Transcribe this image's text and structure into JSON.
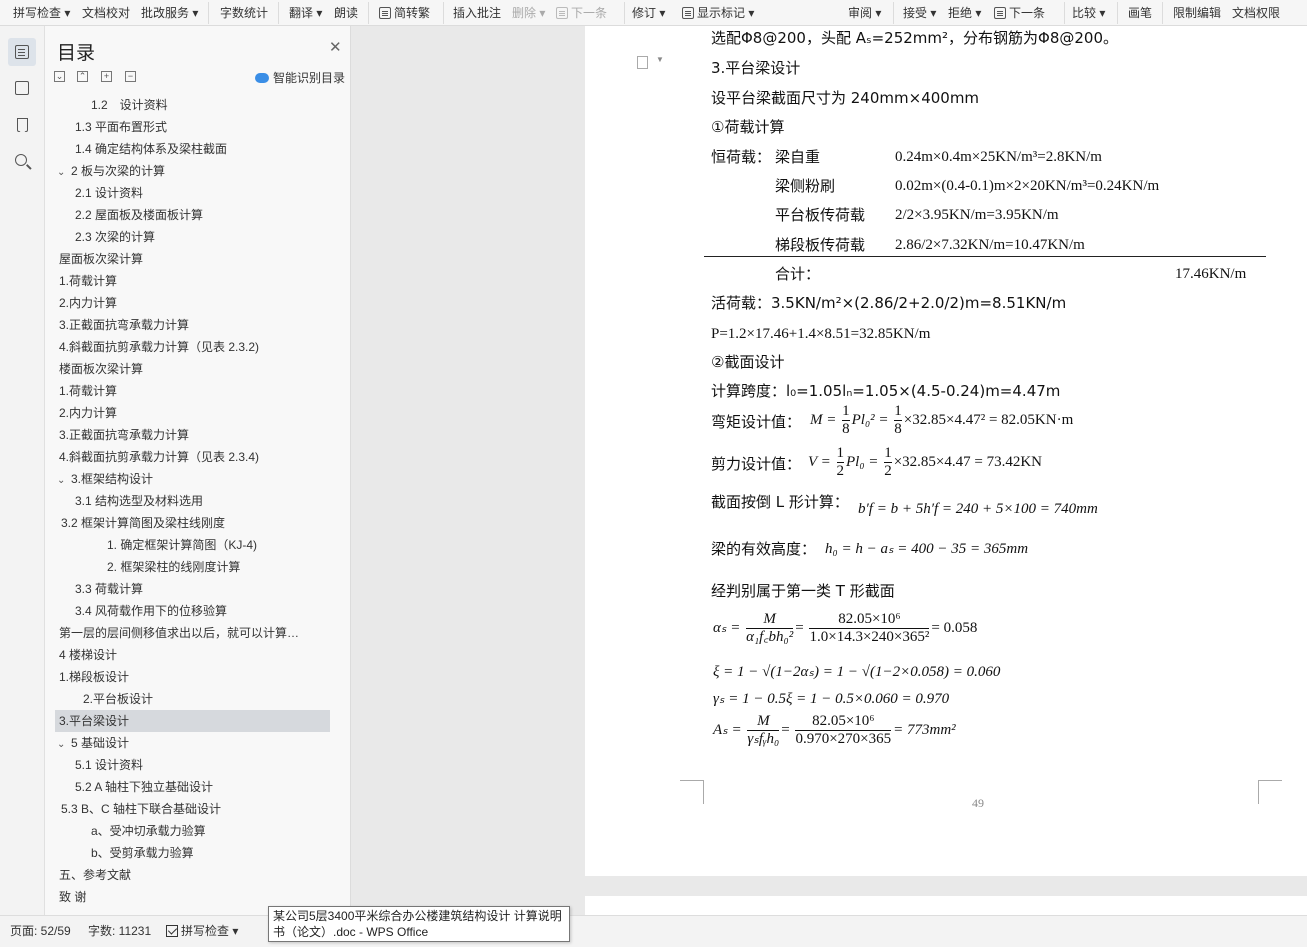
{
  "toolbar": {
    "spellcheck": "拼写检查",
    "proofread": "文档校对",
    "batch": "批改服务",
    "wordcount": "字数统计",
    "translate": "翻译",
    "read": "朗读",
    "simp_trad": "简转繁",
    "insert_comment": "插入批注",
    "delete": "删除",
    "next": "下一条",
    "track": "修订",
    "show_markup": "显示标记",
    "review": "审阅",
    "accept": "接受",
    "reject": "拒绝",
    "next2": "下一条",
    "compare": "比较",
    "pen": "画笔",
    "restrict": "限制编辑",
    "permission": "文档权限"
  },
  "toc": {
    "title": "目录",
    "smart_label": "智能识别目录",
    "items": [
      {
        "text": "1.2　设计资料",
        "toggle": ""
      },
      {
        "text": "1.3  平面布置形式",
        "toggle": ""
      },
      {
        "text": "1.4  确定结构体系及梁柱截面",
        "toggle": ""
      },
      {
        "text": "2  板与次梁的计算",
        "toggle": "⌄"
      },
      {
        "text": "2.1 设计资料",
        "toggle": ""
      },
      {
        "text": "2.2 屋面板及楼面板计算",
        "toggle": ""
      },
      {
        "text": "2.3 次梁的计算",
        "toggle": ""
      },
      {
        "text": "屋面板次梁计算",
        "toggle": ""
      },
      {
        "text": "1.荷载计算",
        "toggle": ""
      },
      {
        "text": "2.内力计算",
        "toggle": ""
      },
      {
        "text": "3.正截面抗弯承载力计算",
        "toggle": ""
      },
      {
        "text": "4.斜截面抗剪承载力计算（见表 2.3.2)",
        "toggle": ""
      },
      {
        "text": "楼面板次梁计算",
        "toggle": ""
      },
      {
        "text": "1.荷载计算",
        "toggle": ""
      },
      {
        "text": "2.内力计算",
        "toggle": ""
      },
      {
        "text": "3.正截面抗弯承载力计算",
        "toggle": ""
      },
      {
        "text": "4.斜截面抗剪承载力计算（见表 2.3.4)",
        "toggle": ""
      },
      {
        "text": "3.框架结构设计",
        "toggle": "⌄"
      },
      {
        "text": "3.1 结构选型及材料选用",
        "toggle": ""
      },
      {
        "text": "3.2 框架计算简图及梁柱线刚度",
        "toggle": "⌄"
      },
      {
        "text": "1. 确定框架计算简图（KJ-4)",
        "toggle": ""
      },
      {
        "text": "2. 框架梁柱的线刚度计算",
        "toggle": ""
      },
      {
        "text": "3.3 荷载计算",
        "toggle": ""
      },
      {
        "text": "3.4 风荷载作用下的位移验算",
        "toggle": ""
      },
      {
        "text": "第一层的层间侧移值求出以后，就可以计算…",
        "toggle": ""
      },
      {
        "text": "4 楼梯设计",
        "toggle": ""
      },
      {
        "text": "1.梯段板设计",
        "toggle": ""
      },
      {
        "text": "2.平台板设计",
        "toggle": ""
      },
      {
        "text": "3.平台梁设计",
        "toggle": ""
      },
      {
        "text": "5 基础设计",
        "toggle": "⌄"
      },
      {
        "text": "5.1 设计资料",
        "toggle": ""
      },
      {
        "text": "5.2 A 轴柱下独立基础设计",
        "toggle": ""
      },
      {
        "text": "5.3 B、C 轴柱下联合基础设计",
        "toggle": "⌄"
      },
      {
        "text": "a、受冲切承载力验算",
        "toggle": ""
      },
      {
        "text": "b、受剪承载力验算",
        "toggle": ""
      },
      {
        "text": "五、参考文献",
        "toggle": ""
      },
      {
        "text": "致  谢",
        "toggle": ""
      }
    ]
  },
  "doc": {
    "line0": "选配Φ8@200，头配 Aₛ=252mm²，分布钢筋为Φ8@200。",
    "h_beam": "3.平台梁设计",
    "section": "设平台梁截面尺寸为 240mm×400mm",
    "h_load": "①荷载计算",
    "dead_label": "恒荷载：",
    "d1_name": "梁自重",
    "d1_val": "0.24m×0.4m×25KN/m³=2.8KN/m",
    "d2_name": "梁侧粉刷",
    "d2_val": "0.02m×(0.4-0.1)m×2×20KN/m³=0.24KN/m",
    "d3_name": "平台板传荷载",
    "d3_val": "2/2×3.95KN/m=3.95KN/m",
    "d4_name": "梯段板传荷载",
    "d4_val": "2.86/2×7.32KN/m=10.47KN/m",
    "sum_label": "合计：",
    "sum_val": "17.46KN/m",
    "live": "活荷载：3.5KN/m²×(2.86/2+2.0/2)m=8.51KN/m",
    "p": "P=1.2×17.46+1.4×8.51=32.85KN/m",
    "h_sec": "②截面设计",
    "span": "计算跨度：l₀=1.05lₙ=1.05×(4.5-0.24)m=4.47m",
    "moment_label": "弯矩设计值：",
    "moment_tail": "×32.85×4.47² = 82.05KN·m",
    "shear_label": "剪力设计值：",
    "shear_tail": "×32.85×4.47 = 73.42KN",
    "flange_label": "截面按倒 L 形计算：",
    "flange_eq": "b′f = b + 5h′f = 240 + 5×100 = 740mm",
    "h0_label": "梁的有效高度：",
    "h0_eq": "h₀ = h − aₛ = 400 − 35 = 365mm",
    "tsec": "经判别属于第一类 T 形截面",
    "alpha_lhs": "αₛ =",
    "alpha_n1": "M",
    "alpha_d1": "α₁f꜀bh₀²",
    "alpha_n2": "82.05×10⁶",
    "alpha_d2": "1.0×14.3×240×365²",
    "alpha_r": "= 0.058",
    "xi": "ξ = 1 − √(1−2αₛ) = 1 − √(1−2×0.058) = 0.060",
    "gamma": "γₛ = 1 − 0.5ξ = 1 − 0.5×0.060 = 0.970",
    "as_lhs": "Aₛ =",
    "as_n1": "M",
    "as_d1": "γₛfᵧh₀",
    "as_n2": "82.05×10⁶",
    "as_d2": "0.970×270×365",
    "as_r": "= 773mm²",
    "page_no": "49"
  },
  "status": {
    "page": "页面: 52/59",
    "words": "字数: 11231",
    "spell": "拼写检查"
  },
  "tooltip": "某公司5层3400平米综合办公楼建筑结构设计 计算说明书（论文）.doc - WPS Office"
}
